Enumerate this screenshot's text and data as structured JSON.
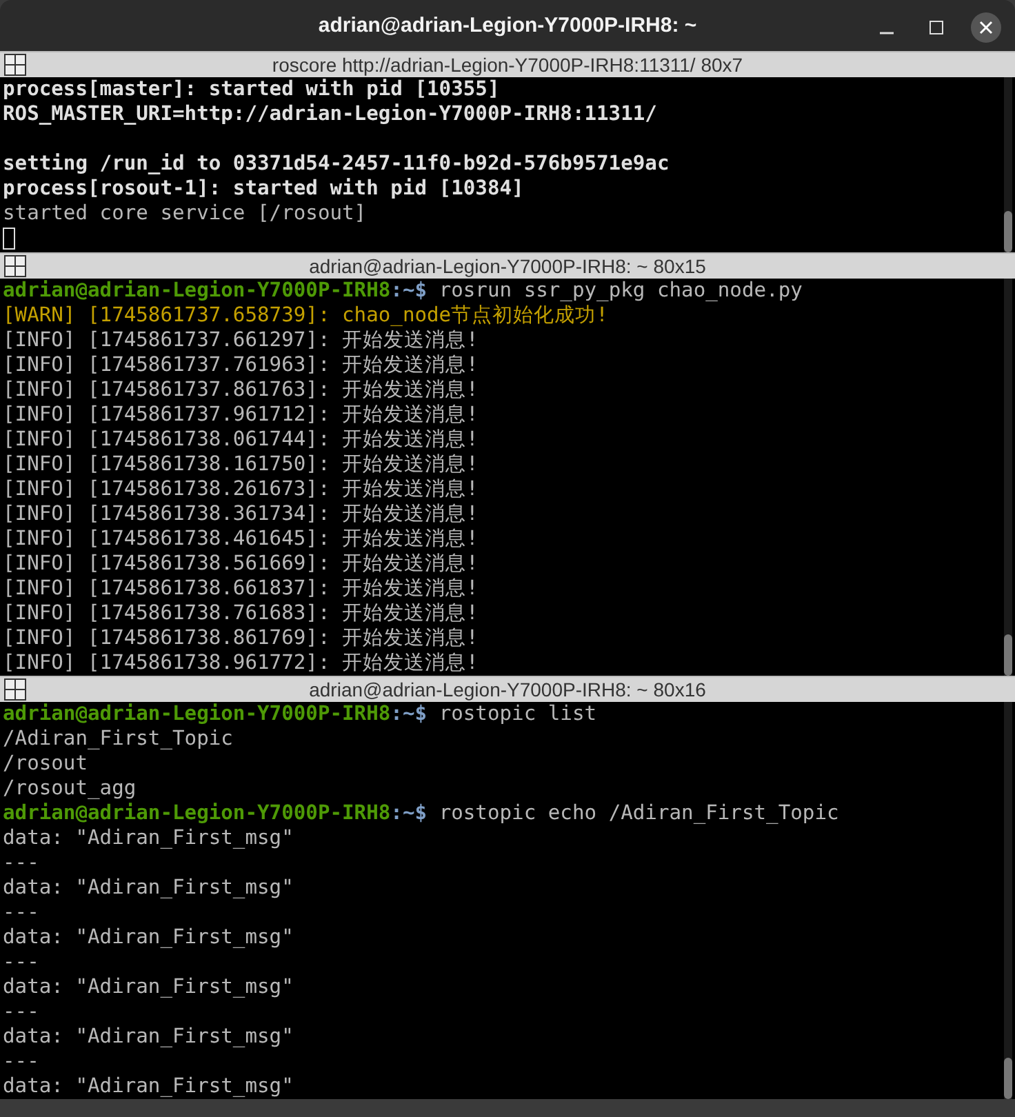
{
  "window": {
    "title": "adrian@adrian-Legion-Y7000P-IRH8: ~"
  },
  "panes": [
    {
      "title": "roscore http://adrian-Legion-Y7000P-IRH8:11311/ 80x7",
      "cursor": true,
      "lines": [
        [
          {
            "kind": "bold",
            "text": "process[master]: started with pid [10355]"
          }
        ],
        [
          {
            "kind": "bold",
            "text": "ROS_MASTER_URI=http://adrian-Legion-Y7000P-IRH8:11311/"
          }
        ],
        [
          {
            "kind": "gap"
          },
          {
            "kind": "bold",
            "text": "setting /run_id to 03371d54-2457-11f0-b92d-576b9571e9ac"
          }
        ],
        [
          {
            "kind": "bold",
            "text": "process[rosout-1]: started with pid [10384]"
          }
        ],
        [
          {
            "kind": "info",
            "text": "started core service [/rosout]"
          }
        ]
      ]
    },
    {
      "title": "adrian@adrian-Legion-Y7000P-IRH8: ~ 80x15",
      "lines": [
        [
          {
            "kind": "user",
            "text": "adrian@adrian-Legion-Y7000P-IRH8"
          },
          {
            "kind": "path",
            "text": ":~$"
          },
          {
            "kind": "info",
            "text": " rosrun ssr_py_pkg chao_node.py"
          }
        ],
        [
          {
            "kind": "warn",
            "text": "[WARN] [1745861737.658739]: chao_node节点初始化成功!"
          }
        ],
        [
          {
            "kind": "info",
            "text": "[INFO] [1745861737.661297]: 开始发送消息!"
          }
        ],
        [
          {
            "kind": "info",
            "text": "[INFO] [1745861737.761963]: 开始发送消息!"
          }
        ],
        [
          {
            "kind": "info",
            "text": "[INFO] [1745861737.861763]: 开始发送消息!"
          }
        ],
        [
          {
            "kind": "info",
            "text": "[INFO] [1745861737.961712]: 开始发送消息!"
          }
        ],
        [
          {
            "kind": "info",
            "text": "[INFO] [1745861738.061744]: 开始发送消息!"
          }
        ],
        [
          {
            "kind": "info",
            "text": "[INFO] [1745861738.161750]: 开始发送消息!"
          }
        ],
        [
          {
            "kind": "info",
            "text": "[INFO] [1745861738.261673]: 开始发送消息!"
          }
        ],
        [
          {
            "kind": "info",
            "text": "[INFO] [1745861738.361734]: 开始发送消息!"
          }
        ],
        [
          {
            "kind": "info",
            "text": "[INFO] [1745861738.461645]: 开始发送消息!"
          }
        ],
        [
          {
            "kind": "info",
            "text": "[INFO] [1745861738.561669]: 开始发送消息!"
          }
        ],
        [
          {
            "kind": "info",
            "text": "[INFO] [1745861738.661837]: 开始发送消息!"
          }
        ],
        [
          {
            "kind": "info",
            "text": "[INFO] [1745861738.761683]: 开始发送消息!"
          }
        ],
        [
          {
            "kind": "info",
            "text": "[INFO] [1745861738.861769]: 开始发送消息!"
          }
        ],
        [
          {
            "kind": "info",
            "text": "[INFO] [1745861738.961772]: 开始发送消息!"
          }
        ]
      ]
    },
    {
      "title": "adrian@adrian-Legion-Y7000P-IRH8: ~ 80x16",
      "lines": [
        [
          {
            "kind": "user",
            "text": "adrian@adrian-Legion-Y7000P-IRH8"
          },
          {
            "kind": "path",
            "text": ":~$"
          },
          {
            "kind": "info",
            "text": " rostopic list"
          }
        ],
        [
          {
            "kind": "info",
            "text": "/Adiran_First_Topic"
          }
        ],
        [
          {
            "kind": "info",
            "text": "/rosout"
          }
        ],
        [
          {
            "kind": "info",
            "text": "/rosout_agg"
          }
        ],
        [
          {
            "kind": "user",
            "text": "adrian@adrian-Legion-Y7000P-IRH8"
          },
          {
            "kind": "path",
            "text": ":~$"
          },
          {
            "kind": "info",
            "text": " rostopic echo /Adiran_First_Topic"
          }
        ],
        [
          {
            "kind": "info",
            "text": "data: \"Adiran_First_msg\""
          }
        ],
        [
          {
            "kind": "info",
            "text": "---"
          }
        ],
        [
          {
            "kind": "info",
            "text": "data: \"Adiran_First_msg\""
          }
        ],
        [
          {
            "kind": "info",
            "text": "---"
          }
        ],
        [
          {
            "kind": "info",
            "text": "data: \"Adiran_First_msg\""
          }
        ],
        [
          {
            "kind": "info",
            "text": "---"
          }
        ],
        [
          {
            "kind": "info",
            "text": "data: \"Adiran_First_msg\""
          }
        ],
        [
          {
            "kind": "info",
            "text": "---"
          }
        ],
        [
          {
            "kind": "info",
            "text": "data: \"Adiran_First_msg\""
          }
        ],
        [
          {
            "kind": "info",
            "text": "---"
          }
        ],
        [
          {
            "kind": "info",
            "text": "data: \"Adiran_First_msg\""
          }
        ]
      ]
    }
  ]
}
